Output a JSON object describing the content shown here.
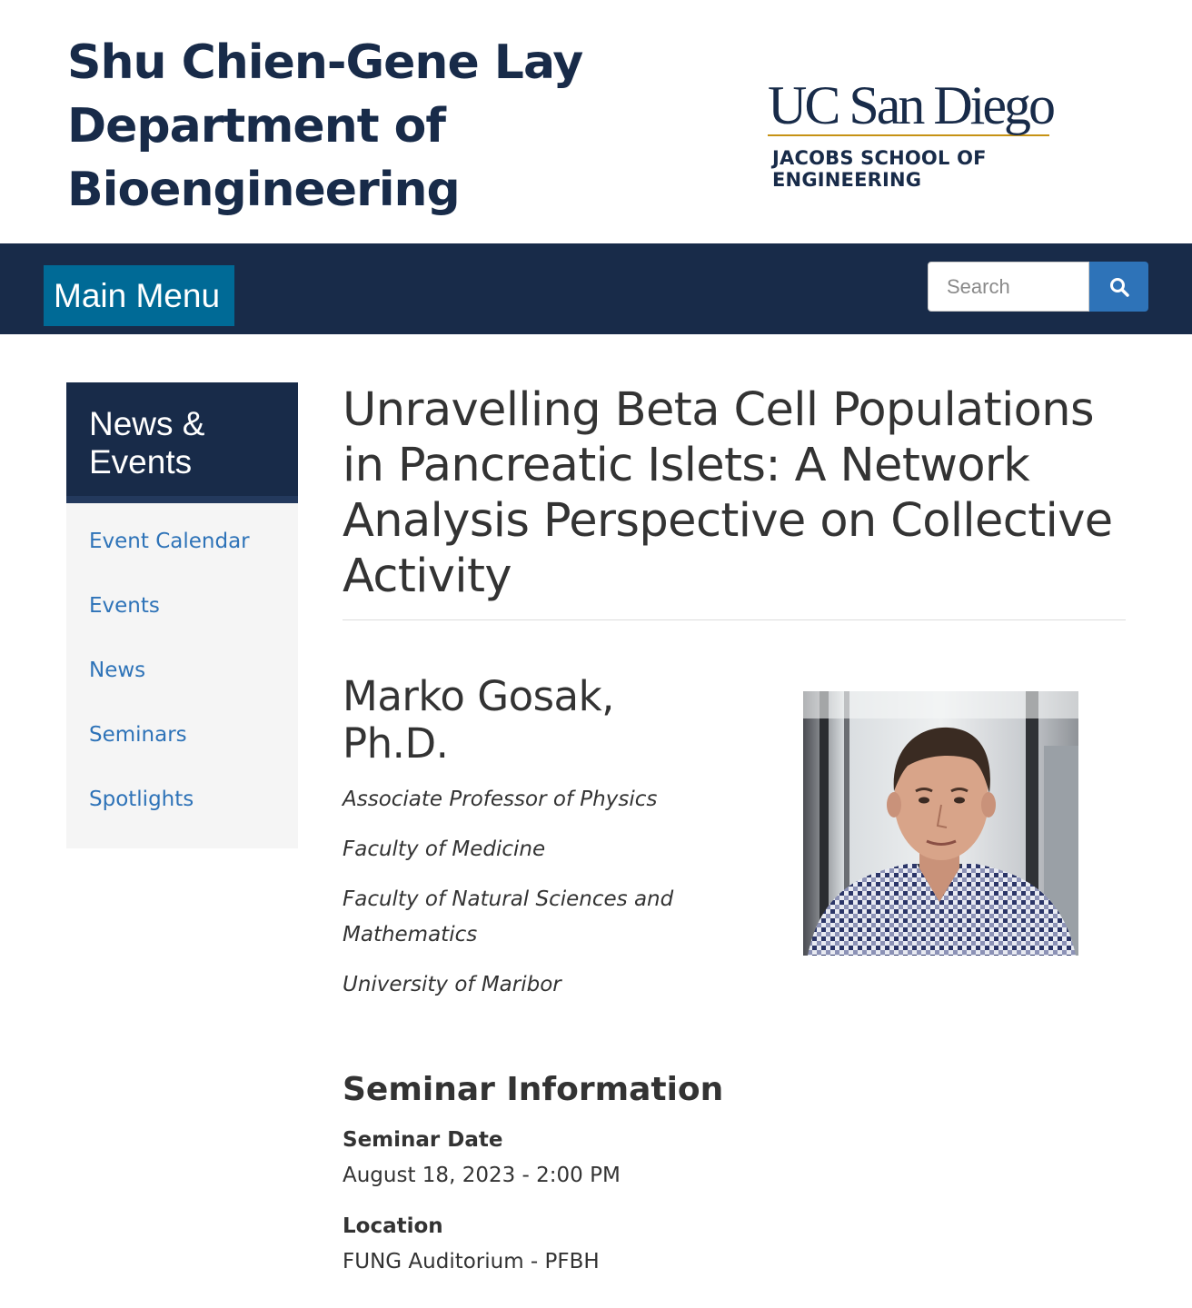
{
  "header": {
    "department_title": "Shu Chien-Gene Lay Department of Bioengineering",
    "logo_primary": "UC San Diego",
    "logo_secondary": "JACOBS SCHOOL OF ENGINEERING"
  },
  "navbar": {
    "menu_label": "Main Menu",
    "search_placeholder": "Search",
    "search_icon": "search-icon"
  },
  "sidebar": {
    "heading": "News & Events",
    "items": [
      {
        "label": "Event Calendar"
      },
      {
        "label": "Events"
      },
      {
        "label": "News"
      },
      {
        "label": "Seminars"
      },
      {
        "label": "Spotlights"
      }
    ]
  },
  "main": {
    "title": "Unravelling Beta Cell Populations in Pancreatic Islets: A Network Analysis Perspective on Collective Activity",
    "speaker": {
      "name": "Marko Gosak, Ph.D.",
      "affiliations": [
        "Associate Professor of Physics",
        "Faculty of Medicine",
        "Faculty of Natural Sciences and Mathematics",
        "University of Maribor"
      ]
    },
    "seminar": {
      "heading": "Seminar Information",
      "date_label": "Seminar Date",
      "date_value": "August 18, 2023 - 2:00 PM",
      "location_label": "Location",
      "location_value": "FUNG Auditorium - PFBH"
    }
  },
  "colors": {
    "navy": "#182b49",
    "menu_blue": "#006a96",
    "link_blue": "#2e73b8",
    "gold": "#c69214"
  }
}
